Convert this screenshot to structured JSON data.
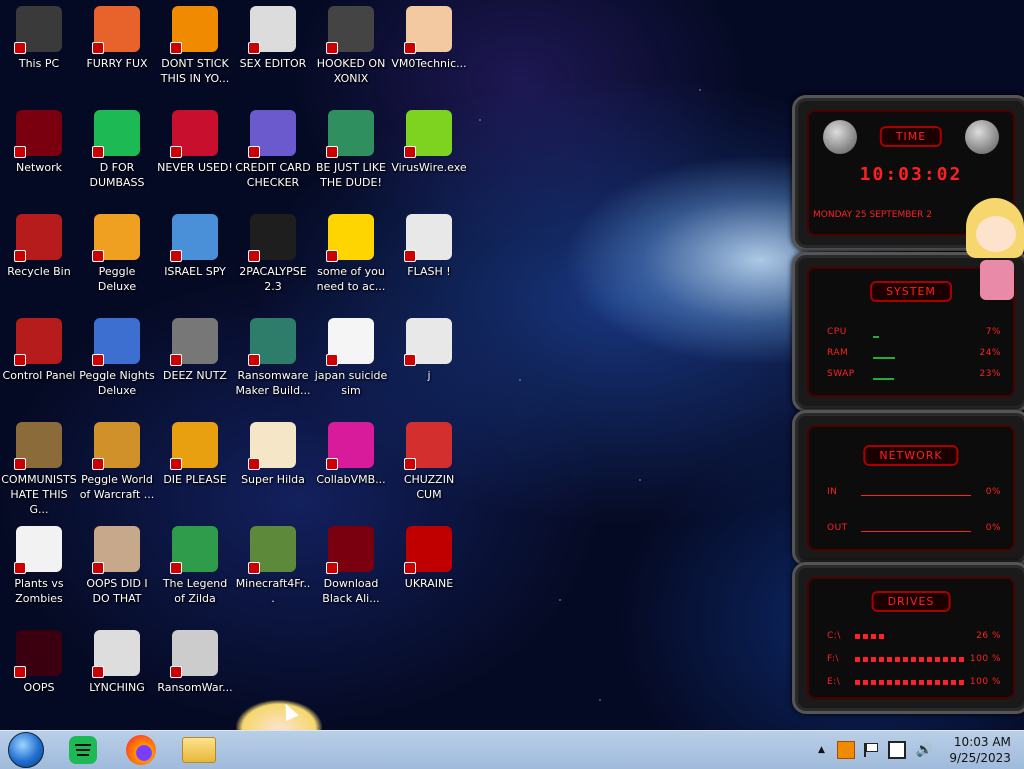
{
  "desktop": {
    "icons": [
      {
        "label": "This PC",
        "icon": "computer-icon",
        "color": "#3a3a3a"
      },
      {
        "label": "FURRY FUX",
        "icon": "firefox-icon",
        "color": "#e8632b"
      },
      {
        "label": "DONT STICK THIS IN YO...",
        "icon": "vlc-cone-icon",
        "color": "#f08a00"
      },
      {
        "label": "SEX EDITOR",
        "icon": "hxd-icon",
        "color": "#dcdcdc"
      },
      {
        "label": "HOOKED ON XONIX",
        "icon": "xonix-icon",
        "color": "#444444"
      },
      {
        "label": "VM0Technic...",
        "icon": "technician-icon",
        "color": "#f2c9a0"
      },
      {
        "label": "Network",
        "icon": "alien-orb-icon",
        "color": "#7a0010"
      },
      {
        "label": "D FOR DUMBASS",
        "icon": "spotify-icon",
        "color": "#1db954"
      },
      {
        "label": "NEVER USED!",
        "icon": "devcpp-icon",
        "color": "#c8102e"
      },
      {
        "label": "CREDIT CARD CHECKER",
        "icon": "credit-card-icon",
        "color": "#6a5acd"
      },
      {
        "label": "BE JUST LIKE THE DUDE!",
        "icon": "santa-icon",
        "color": "#2f8f5f"
      },
      {
        "label": "VirusWire.exe",
        "icon": "lime-icon",
        "color": "#7ed321"
      },
      {
        "label": "Recycle Bin",
        "icon": "recycle-bin-icon",
        "color": "#b71c1c"
      },
      {
        "label": "Peggle Deluxe",
        "icon": "peggle-icon",
        "color": "#f0a020"
      },
      {
        "label": "ISRAEL SPY",
        "icon": "network-spy-icon",
        "color": "#4a90d9"
      },
      {
        "label": "2PACALYPSE 2.3",
        "icon": "terminal-icon",
        "color": "#1e1e1e"
      },
      {
        "label": "some of you need to ac...",
        "icon": "dog-icon",
        "color": "#ffd500"
      },
      {
        "label": "FLASH !",
        "icon": "flash-icon",
        "color": "#e8e8e8"
      },
      {
        "label": "Control Panel",
        "icon": "control-panel-icon",
        "color": "#b71c1c"
      },
      {
        "label": "Peggle Nights Deluxe",
        "icon": "peggle-nights-icon",
        "color": "#3d6fd1"
      },
      {
        "label": "DEEZ NUTZ",
        "icon": "stacked-windows-icon",
        "color": "#777777"
      },
      {
        "label": "Ransomware Maker Build...",
        "icon": "app-window-icon",
        "color": "#2e7d6b"
      },
      {
        "label": "japan suicide sim",
        "icon": "document-icon",
        "color": "#f5f5f5"
      },
      {
        "label": "j",
        "icon": "flash-icon",
        "color": "#e8e8e8"
      },
      {
        "label": "COMMUNISTS HATE THIS G...",
        "icon": "money-bag-icon",
        "color": "#8b6b3a"
      },
      {
        "label": "Peggle World of Warcraft ...",
        "icon": "peggle-wow-icon",
        "color": "#d0902a"
      },
      {
        "label": "DIE PLEASE",
        "icon": "de-icon",
        "color": "#e8a010"
      },
      {
        "label": "Super Hilda",
        "icon": "pixel-art-icon",
        "color": "#f5e6c8"
      },
      {
        "label": "CollabVMB...",
        "icon": "collabvm-icon",
        "color": "#d81b9b"
      },
      {
        "label": "CHUZZIN CUM",
        "icon": "chuzzle-icon",
        "color": "#d32f2f"
      },
      {
        "label": "Plants vs Zombies",
        "icon": "flower-icon",
        "color": "#f2f2f2"
      },
      {
        "label": "OOPS DID I DO THAT",
        "icon": "portrait-icon",
        "color": "#c8a88a"
      },
      {
        "label": "The Legend of Zilda",
        "icon": "pixel-hero-icon",
        "color": "#2e9c4a"
      },
      {
        "label": "Minecraft4Fr...",
        "icon": "grass-block-icon",
        "color": "#5d8a3a"
      },
      {
        "label": "Download Black Ali...",
        "icon": "alien-orb-icon",
        "color": "#7a0010"
      },
      {
        "label": "UKRAINE",
        "icon": "radiation-icon",
        "color": "#c00000"
      },
      {
        "label": "OOPS",
        "icon": "skull-box-icon",
        "color": "#3a0010"
      },
      {
        "label": "LYNCHING",
        "icon": "noose-icon",
        "color": "#dddddd"
      },
      {
        "label": "RansomWar...",
        "icon": "skull-icon",
        "color": "#cccccc"
      }
    ]
  },
  "gadget": {
    "time": {
      "title": "TIME",
      "clock": "10:03:02",
      "date": "MONDAY 25 SEPTEMBER 2"
    },
    "system": {
      "title": "SYSTEM",
      "rows": [
        {
          "label": "CPU",
          "value": "7%",
          "level": 0.07
        },
        {
          "label": "RAM",
          "value": "24%",
          "level": 0.24
        },
        {
          "label": "SWAP",
          "value": "23%",
          "level": 0.23
        }
      ]
    },
    "network": {
      "title": "NETWORK",
      "rows": [
        {
          "label": "IN",
          "value": "0%"
        },
        {
          "label": "OUT",
          "value": "0%"
        }
      ]
    },
    "drives": {
      "title": "DRIVES",
      "rows": [
        {
          "label": "C:\\",
          "value": "26 %",
          "level": 0.26
        },
        {
          "label": "F:\\",
          "value": "100 %",
          "level": 1.0
        },
        {
          "label": "E:\\",
          "value": "100 %",
          "level": 1.0
        }
      ]
    }
  },
  "taskbar": {
    "pinned": [
      {
        "name": "start-orb",
        "icon": "windows-orb-icon"
      },
      {
        "name": "spotify",
        "icon": "spotify-icon"
      },
      {
        "name": "firefox",
        "icon": "firefox-icon"
      },
      {
        "name": "explorer",
        "icon": "folder-icon"
      }
    ],
    "tray": {
      "chevron": "▲",
      "time": "10:03 AM",
      "date": "9/25/2023"
    }
  },
  "colors": {
    "accent_red": "#ff2222",
    "taskbar": "#a9c3e0"
  }
}
